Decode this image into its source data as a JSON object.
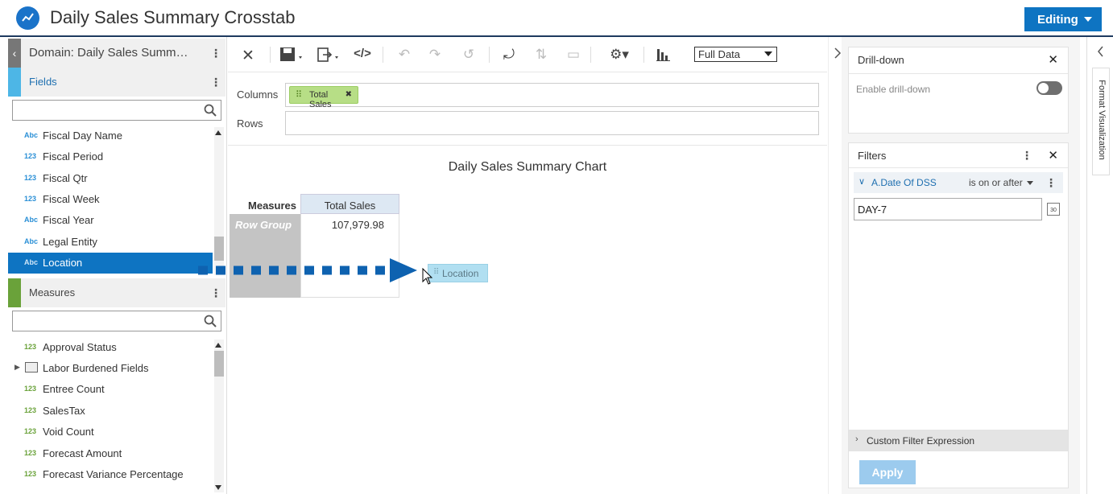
{
  "header": {
    "title": "Daily Sales Summary Crosstab",
    "mode_button": "Editing"
  },
  "left_panel": {
    "domain": "Domain: Daily Sales Summ…",
    "fields_section": "Fields",
    "fields": [
      {
        "type": "Abc",
        "name": "Fiscal Day Name"
      },
      {
        "type": "123",
        "name": "Fiscal Period"
      },
      {
        "type": "123",
        "name": "Fiscal Qtr"
      },
      {
        "type": "123",
        "name": "Fiscal Week"
      },
      {
        "type": "Abc",
        "name": "Fiscal Year"
      },
      {
        "type": "Abc",
        "name": "Legal Entity"
      },
      {
        "type": "Abc",
        "name": "Location"
      }
    ],
    "measures_section": "Measures",
    "measures": [
      {
        "type": "123",
        "name": "Approval Status"
      },
      {
        "type": "",
        "name": "Labor Burdened Fields"
      },
      {
        "type": "123",
        "name": "Entree Count"
      },
      {
        "type": "123",
        "name": "SalesTax"
      },
      {
        "type": "123",
        "name": "Void Count"
      },
      {
        "type": "123",
        "name": "Forecast Amount"
      },
      {
        "type": "123",
        "name": "Forecast Variance Percentage"
      }
    ]
  },
  "toolbar": {
    "data_mode": "Full Data"
  },
  "shelves": {
    "columns_label": "Columns",
    "rows_label": "Rows",
    "column_pill": "Total Sales"
  },
  "chart": {
    "title": "Daily Sales Summary Chart"
  },
  "crosstab": {
    "measures_label": "Measures",
    "column_header": "Total Sales",
    "row_group": "Row Group",
    "value": "107,979.98"
  },
  "drag": {
    "pill_label": "Location"
  },
  "drilldown": {
    "title": "Drill-down",
    "label": "Enable drill-down"
  },
  "filters": {
    "title": "Filters",
    "filter_name": "A.Date Of DSS",
    "operator": "is on or after",
    "value": "DAY-7",
    "custom_expression": "Custom Filter Expression",
    "apply": "Apply"
  },
  "format_tab": "Format Visualization",
  "colors": {
    "accent": "#0e74c2",
    "fields_accent": "#4db6e6",
    "measures_accent": "#6aa23a",
    "pill_green": "#b7de86",
    "selected": "#0e74c2"
  }
}
